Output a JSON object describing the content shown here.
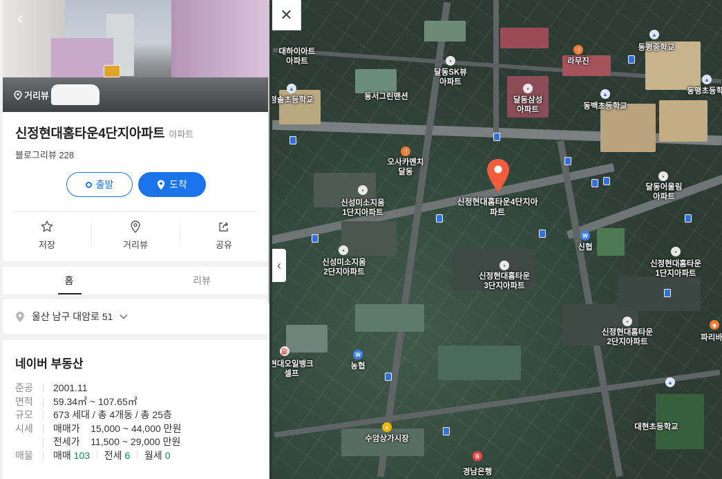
{
  "panel": {
    "streetview_tag": "거리뷰",
    "place": {
      "name": "신정현대홈타운4단지아파트",
      "category": "아파트",
      "review": "블로그리뷰 228"
    },
    "route": {
      "depart": "출발",
      "arrive": "도착"
    },
    "actions": [
      {
        "label": "저장",
        "icon": "star-icon"
      },
      {
        "label": "거리뷰",
        "icon": "map-pin-outline-icon"
      },
      {
        "label": "공유",
        "icon": "share-icon"
      }
    ],
    "tabs": {
      "home": "홈",
      "review": "리뷰"
    },
    "address": "울산 남구 대암로 51",
    "estate": {
      "title": "네이버 부동산",
      "rows": [
        {
          "k": "준공",
          "v": "2001.11"
        },
        {
          "k": "면적",
          "v": "59.34㎡ ~ 107.65㎡"
        },
        {
          "k": "규모",
          "v": "673 세대 / 총 4개동 / 총 25층"
        },
        {
          "k": "시세",
          "v": "매매가    15,000 ~ 44,000 만원"
        },
        {
          "k": "",
          "v": "전세가    11,500 ~ 29,000 만원"
        }
      ],
      "listing_key": "매물",
      "listing": {
        "sale_label": "매매",
        "sale": "103",
        "jeonse_label": "전세",
        "jeonse": "6",
        "monthly_label": "월세",
        "monthly": "0"
      }
    }
  },
  "map": {
    "close": "✕",
    "collapse": "‹",
    "selected_label": "신정현대홈타운4단지아\n파트",
    "labels": [
      {
        "id": "dahaiaan",
        "text": "대하이아트\n아파트"
      },
      {
        "id": "daldong-sk",
        "text": "달동SK뷰\n아파트"
      },
      {
        "id": "dongseo",
        "text": "동서그린맨션"
      },
      {
        "id": "daldong-samsung",
        "text": "달동삼성\n아파트"
      },
      {
        "id": "ramujin",
        "text": "라무진"
      },
      {
        "id": "dongpyeong-ms",
        "text": "동평중학교"
      },
      {
        "id": "dongpyeong-es",
        "text": "동평초등학교"
      },
      {
        "id": "dongbaek-es",
        "text": "동백초등학교"
      },
      {
        "id": "sinseong-es",
        "text": "정솔초등학교"
      },
      {
        "id": "osaka",
        "text": "오사카멘치\n달동"
      },
      {
        "id": "daldong-eoullim",
        "text": "달동어울림\n아파트"
      },
      {
        "id": "sinseong-miso1",
        "text": "신성미소지움\n1단지아파트"
      },
      {
        "id": "sinseong-miso2",
        "text": "신성미소지움\n2단지아파트"
      },
      {
        "id": "sinhyeop",
        "text": "신협"
      },
      {
        "id": "hometown3",
        "text": "신정현대홈타운\n3단지아파트"
      },
      {
        "id": "hometown1",
        "text": "신정현대홈타운\n1단지아파트"
      },
      {
        "id": "hometown2",
        "text": "신정현대홈타운\n2단지아파트"
      },
      {
        "id": "paris",
        "text": "파리바"
      },
      {
        "id": "oilbank",
        "text": "현대오일뱅크\n셀프"
      },
      {
        "id": "nonghyup",
        "text": "농협"
      },
      {
        "id": "suam",
        "text": "수암상가시장"
      },
      {
        "id": "daehyeon",
        "text": "대현초등학교"
      },
      {
        "id": "gyeongnam",
        "text": "경남은행"
      }
    ]
  }
}
